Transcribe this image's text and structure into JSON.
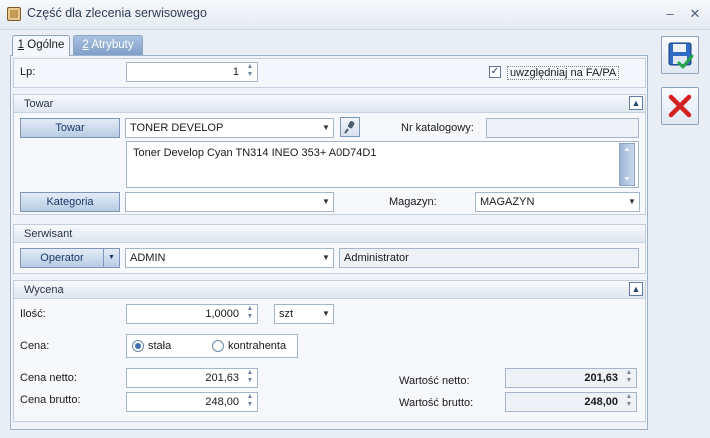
{
  "window": {
    "title": "Część dla zlecenia serwisowego",
    "minimize": "–",
    "close": "✕"
  },
  "tabs": [
    {
      "num": "1",
      "rest": " Ogólne"
    },
    {
      "num": "2",
      "rest": " Atrybuty"
    }
  ],
  "lp": {
    "label": "Lp:",
    "value": "1",
    "checkbox_label": "uwzględniaj na FA/PA",
    "checkbox_mark": "✓"
  },
  "towar": {
    "section_title": "Towar",
    "button": "Towar",
    "code": "TONER DEVELOP",
    "nr_label": "Nr katalogowy:",
    "nr_value": "",
    "description": "Toner Develop Cyan TN314 INEO 353+ A0D74D1",
    "kategoria_button": "Kategoria",
    "kategoria_value": "",
    "magazyn_label": "Magazyn:",
    "magazyn_value": "MAGAZYN"
  },
  "serwisant": {
    "section_title": "Serwisant",
    "button": "Operator",
    "code": "ADMIN",
    "name": "Administrator"
  },
  "wycena": {
    "section_title": "Wycena",
    "ilosc_label": "Ilość:",
    "ilosc_value": "1,0000",
    "unit": "szt",
    "cena_label": "Cena:",
    "radio_stala": "stała",
    "radio_kontrahenta": "kontrahenta",
    "netto_label": "Cena netto:",
    "netto_value": "201,63",
    "brutto_label": "Cena brutto:",
    "brutto_value": "248,00",
    "wartosc_netto_label": "Wartość netto:",
    "wartosc_netto_value": "201,63",
    "wartosc_brutto_label": "Wartość brutto:",
    "wartosc_brutto_value": "248,00"
  },
  "icons": {
    "collapse": "▲",
    "dropdown": "▼",
    "spin_up": "▲",
    "spin_down": "▼"
  },
  "colors": {
    "save_accent": "#2f6bc4",
    "cancel_red": "#d42020"
  }
}
